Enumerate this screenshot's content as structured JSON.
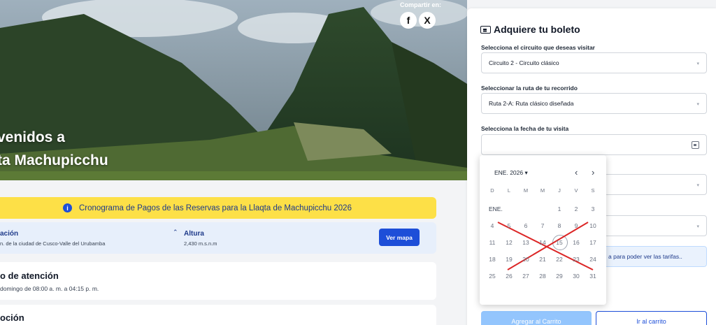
{
  "hero": {
    "title_line1": "venidos a",
    "title_line2": "ta Machupicchu",
    "share_label": "Compartir en:",
    "facebook_glyph": "f",
    "x_glyph": "X"
  },
  "notice": {
    "text": "Cronograma de Pagos de las Reservas para la Llaqta de Machupicchu 2026",
    "icon_glyph": "i"
  },
  "location": {
    "title": "ación",
    "subtitle": "n. de la ciudad de Cusco-Valle del Urubamba",
    "altitude_title": "Altura",
    "altitude_value": "2,430 m.s.n.m",
    "map_button": "Ver mapa"
  },
  "schedule": {
    "title": "o de atención",
    "text": "domingo de 08:00 a. m. a 04:15 p. m."
  },
  "next_card": {
    "title": "oción"
  },
  "panel": {
    "title": "Adquiere tu boleto",
    "circuit_label": "Selecciona el circuito que deseas visitar",
    "circuit_value": "Circuito 2 - Circuito clásico",
    "route_label": "Seleccionar la ruta de tu recorrido",
    "route_value": "Ruta 2-A: Ruta clásico diseñada",
    "date_label": "Selecciona la fecha de tu visita",
    "date_value": "",
    "info_text": "a para poder ver las tarifas..",
    "add_cart": "Agregar al Carrito",
    "go_cart": "Ir al carrito"
  },
  "calendar": {
    "month_label": "ENE. 2026 ▾",
    "prev_glyph": "‹",
    "next_glyph": "›",
    "weekdays": [
      "D",
      "L",
      "M",
      "M",
      "J",
      "V",
      "S"
    ],
    "month_short": "ENE.",
    "weeks": [
      [
        "",
        "",
        "",
        "",
        "1",
        "2",
        "3"
      ],
      [
        "4",
        "5",
        "6",
        "7",
        "8",
        "9",
        "10"
      ],
      [
        "11",
        "12",
        "13",
        "14",
        "15",
        "16",
        "17"
      ],
      [
        "18",
        "19",
        "20",
        "21",
        "22",
        "23",
        "24"
      ],
      [
        "25",
        "26",
        "27",
        "28",
        "29",
        "30",
        "31"
      ]
    ],
    "highlighted_day": "15",
    "cross_color": "#dc2626"
  },
  "colors": {
    "primary": "#1d4ed8",
    "notice_bg": "#fde047",
    "panel_bg": "#ffffff"
  }
}
